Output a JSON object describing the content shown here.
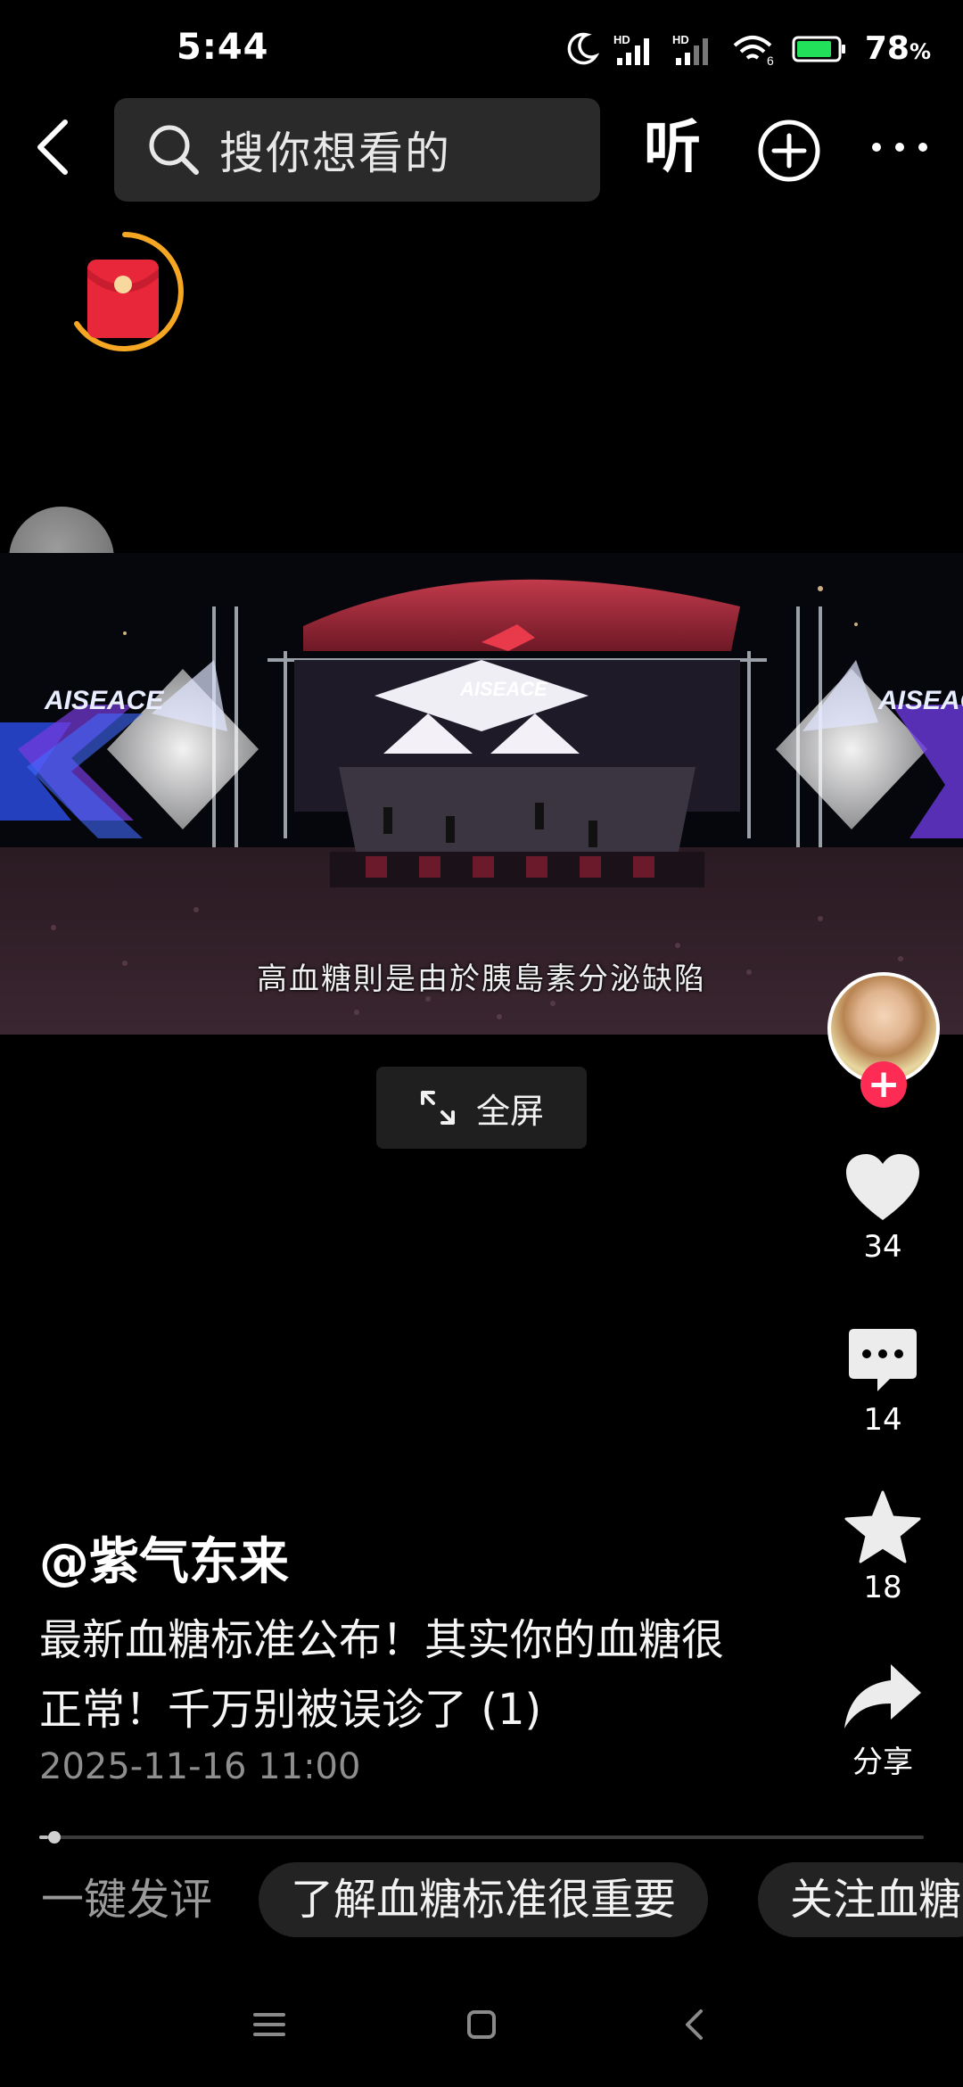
{
  "status_bar": {
    "time": "5:44",
    "battery_percent": "78",
    "battery_unit": "%",
    "network": "HD",
    "wifi_badge": "6"
  },
  "top_nav": {
    "search_placeholder": "搜你想看的",
    "listen_label": "听"
  },
  "video": {
    "subtitle": "高血糖則是由於胰島素分泌缺陷",
    "banner_logo_text": "AISEACE"
  },
  "fullscreen": {
    "label": "全屏"
  },
  "rail": {
    "like_count": "34",
    "comment_count": "14",
    "favorite_count": "18",
    "share_label": "分享",
    "follow_symbol": "+"
  },
  "post": {
    "author": "@紫气东来",
    "description": "最新血糖标准公布！其实你的血糖很正常！千万别被误诊了 (1)",
    "date": "2025-11-16 11:00",
    "progress": 0.01
  },
  "quick_comments": {
    "label": "一键发评",
    "chips": [
      "了解血糖标准很重要",
      "关注血糖"
    ]
  },
  "colors": {
    "accent": "#fe2c55",
    "redpacket_ring": "#f5a623",
    "background": "#000000"
  }
}
